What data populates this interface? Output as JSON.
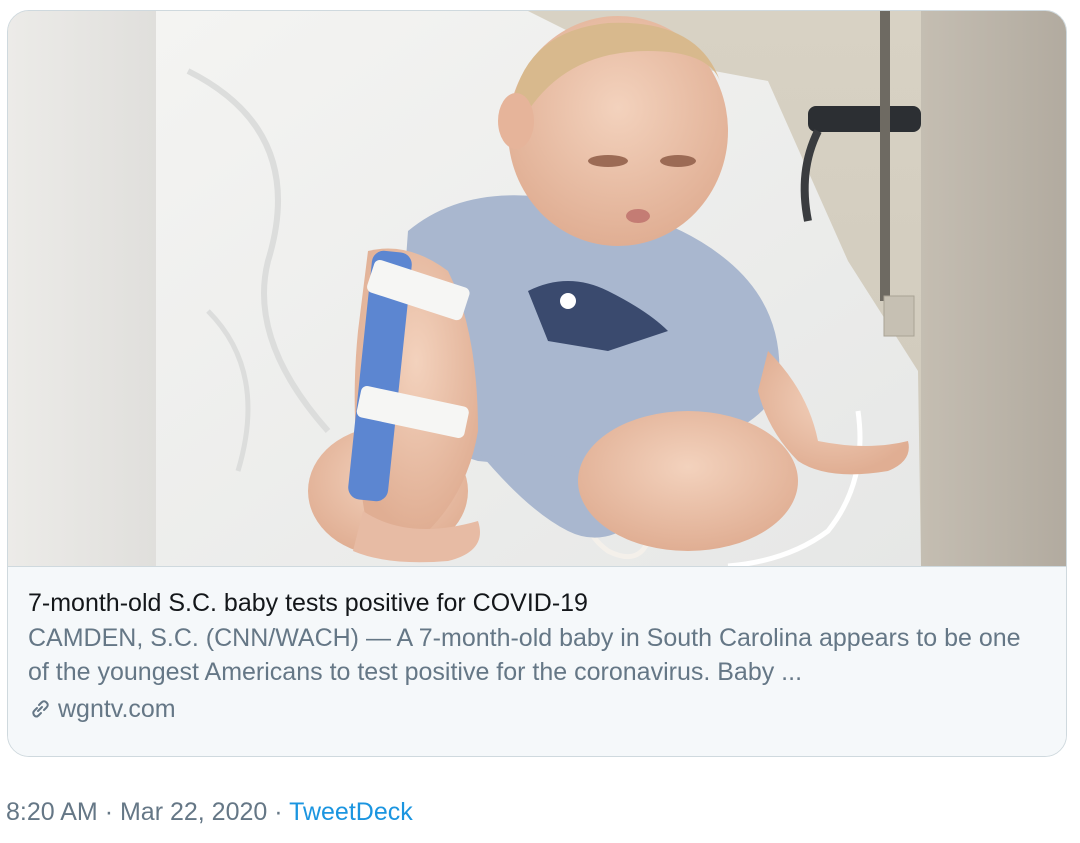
{
  "card": {
    "title": "7-month-old S.C. baby tests positive for COVID-19",
    "description": "CAMDEN, S.C. (CNN/WACH) — A 7-month-old baby in South Carolina appears to be one of the youngest Americans to test positive for the coronavirus. Baby ...",
    "domain": "wgntv.com",
    "domain_icon": "link-icon"
  },
  "tweet_meta": {
    "time": "8:20 AM",
    "separator": "·",
    "date": "Mar 22, 2020",
    "source": "TweetDeck"
  },
  "colors": {
    "title": "#14171a",
    "secondary": "#657786",
    "link": "#1b95e0",
    "card_border": "#cfd9de",
    "card_bg": "#f5f8fa"
  }
}
